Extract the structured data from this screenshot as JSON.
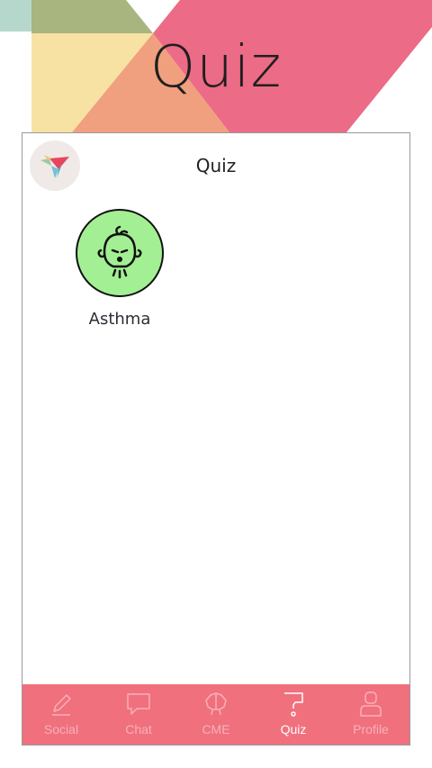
{
  "header": {
    "title": "Quiz"
  },
  "screen": {
    "title": "Quiz",
    "logo_icon": "origami-bird-icon"
  },
  "quizzes": [
    {
      "label": "Asthma",
      "icon": "baby-coughing-icon",
      "icon_bg": "#a3ef93"
    }
  ],
  "tabbar": {
    "background": "#f0707e",
    "items": [
      {
        "label": "Social",
        "icon": "pencil-icon"
      },
      {
        "label": "Chat",
        "icon": "chat-bubble-icon"
      },
      {
        "label": "CME",
        "icon": "brain-icon"
      },
      {
        "label": "Quiz",
        "icon": "question-icon",
        "active": true
      },
      {
        "label": "Profile",
        "icon": "person-icon"
      }
    ]
  }
}
